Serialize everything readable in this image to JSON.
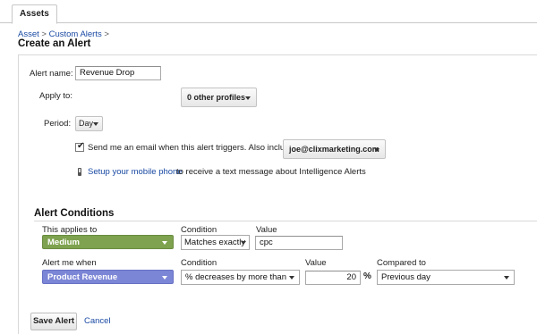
{
  "tabs": {
    "assets": "Assets"
  },
  "breadcrumb": {
    "asset": "Asset",
    "sep1": ">",
    "custom_alerts": "Custom Alerts",
    "sep2": ">"
  },
  "page_title": "Create an Alert",
  "form": {
    "alert_name_label": "Alert name:",
    "alert_name_value": "Revenue Drop",
    "apply_to_label": "Apply to:",
    "apply_to_value": "0 other profiles",
    "period_label": "Period:",
    "period_value": "Day",
    "email_checked": true,
    "email_text": "Send me an email when this alert triggers. Also include",
    "email_value": "joe@clixmarketing.com",
    "mobile_link": "Setup your mobile phone",
    "mobile_text": "to receive a text message about Intelligence Alerts"
  },
  "conditions": {
    "title": "Alert Conditions",
    "row1": {
      "applies_label": "This applies to",
      "applies_value": "Medium",
      "condition_label": "Condition",
      "condition_value": "Matches exactly",
      "value_label": "Value",
      "value_value": "cpc"
    },
    "row2": {
      "alert_label": "Alert me when",
      "alert_value": "Product Revenue",
      "condition_label": "Condition",
      "condition_value": "% decreases by more than",
      "value_label": "Value",
      "value_value": "20",
      "percent": "%",
      "compared_label": "Compared to",
      "compared_value": "Previous day"
    }
  },
  "actions": {
    "save": "Save Alert",
    "cancel": "Cancel"
  },
  "colors": {
    "link": "#1a4aa3",
    "green_dimension": "#7ea24f",
    "blue_metric": "#7c86d6"
  }
}
